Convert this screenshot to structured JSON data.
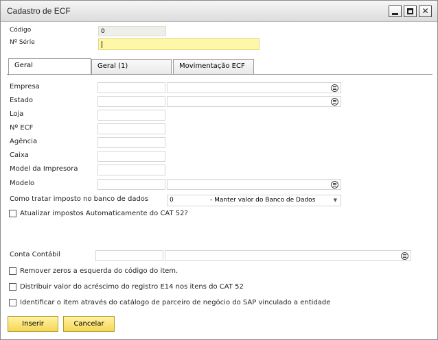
{
  "window": {
    "title": "Cadastro de ECF"
  },
  "window_buttons": {
    "minimize_icon": "minimize-icon",
    "maximize_icon": "maximize-icon",
    "close_glyph": "✕"
  },
  "header": {
    "codigo_label": "Código",
    "codigo_value": "0",
    "serie_label": "Nº Série",
    "serie_value": ""
  },
  "tabs": [
    {
      "label": "Geral",
      "active": true
    },
    {
      "label": "Geral (1)",
      "active": false
    },
    {
      "label": "Movimentação ECF",
      "active": false
    }
  ],
  "form": {
    "empresa_label": "Empresa",
    "estado_label": "Estado",
    "loja_label": "Loja",
    "necf_label": "Nº ECF",
    "agencia_label": "Agência",
    "caixa_label": "Caixa",
    "model_impressora_label": "Model da Impresora",
    "modelo_label": "Modelo",
    "imposto_label": "Como tratar imposto no banco de dados",
    "imposto_code": "0",
    "imposto_desc": "- Manter valor do Banco de Dados",
    "atualizar_label": "Atualizar impostos Automaticamente do CAT 52?",
    "conta_contabil_label": "Conta Contábil",
    "remover_zeros_label": "Remover zeros a esquerda do código do item.",
    "distribuir_label": "Distribuir valor do acréscimo do registro E14 nos itens do CAT 52",
    "identificar_label": "Identificar o item através do catálogo de parceiro de negócio do SAP vinculado a entidade"
  },
  "footer": {
    "inserir_label": "Inserir",
    "cancelar_label": "Cancelar"
  }
}
